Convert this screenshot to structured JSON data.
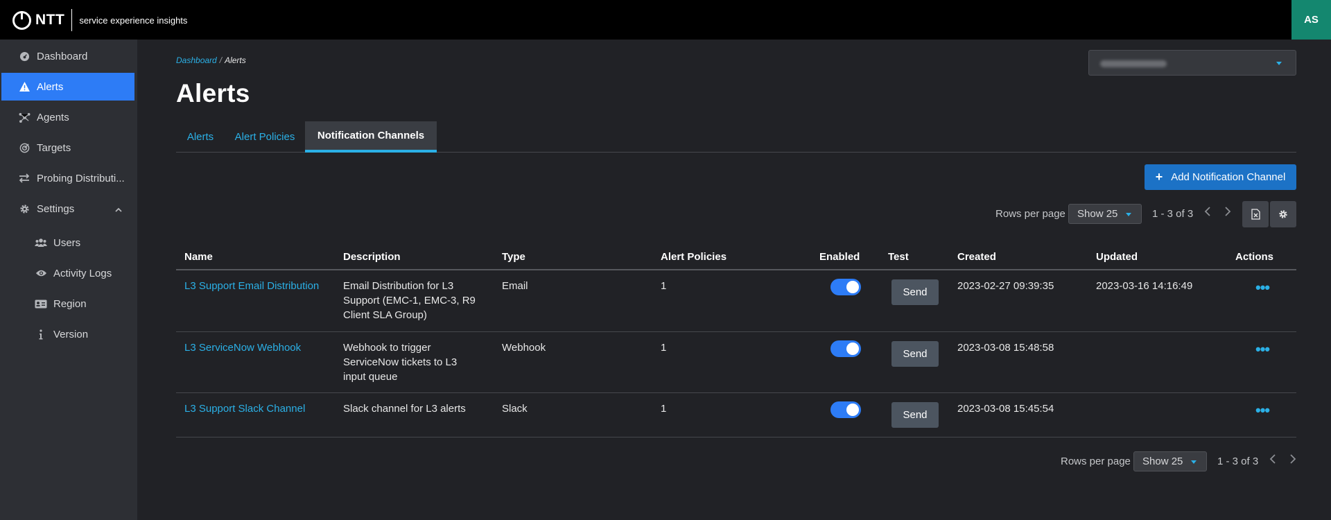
{
  "header": {
    "logo_text": "NTT",
    "app_subtitle": "service experience insights",
    "user_initials": "AS"
  },
  "sidebar": {
    "items": [
      {
        "label": "Dashboard",
        "icon": "dashboard-icon"
      },
      {
        "label": "Alerts",
        "icon": "warning-icon",
        "active": true
      },
      {
        "label": "Agents",
        "icon": "agents-icon"
      },
      {
        "label": "Targets",
        "icon": "target-icon"
      },
      {
        "label": "Probing Distributi...",
        "icon": "swap-arrows-icon"
      },
      {
        "label": "Settings",
        "icon": "gear-icon",
        "expanded": true
      },
      {
        "label": "Users",
        "icon": "users-icon"
      },
      {
        "label": "Activity Logs",
        "icon": "eye-icon"
      },
      {
        "label": "Region",
        "icon": "id-card-icon"
      },
      {
        "label": "Version",
        "icon": "info-icon"
      }
    ]
  },
  "breadcrumb": {
    "root": "Dashboard",
    "separator": "/",
    "current": "Alerts"
  },
  "page": {
    "title": "Alerts"
  },
  "tabs": [
    {
      "label": "Alerts"
    },
    {
      "label": "Alert Policies"
    },
    {
      "label": "Notification Channels",
      "active": true
    }
  ],
  "toolbar": {
    "add_label": "Add Notification Channel"
  },
  "pager": {
    "rows_per_page_label": "Rows per page",
    "show_value": "Show 25",
    "range": "1 - 3 of 3"
  },
  "table": {
    "columns": [
      "Name",
      "Description",
      "Type",
      "Alert Policies",
      "Enabled",
      "Test",
      "Created",
      "Updated",
      "Actions"
    ],
    "rows": [
      {
        "name": "L3 Support Email Distribution",
        "description": "Email Distribution for L3 Support (EMC-1, EMC-3, R9 Client SLA Group)",
        "type": "Email",
        "alert_policies": "1",
        "enabled": true,
        "test_label": "Send",
        "created": "2023-02-27 09:39:35",
        "updated": "2023-03-16 14:16:49"
      },
      {
        "name": "L3 ServiceNow Webhook",
        "description": "Webhook to trigger ServiceNow tickets to L3 input queue",
        "type": "Webhook",
        "alert_policies": "1",
        "enabled": true,
        "test_label": "Send",
        "created": "2023-03-08 15:48:58",
        "updated": ""
      },
      {
        "name": "L3 Support Slack Channel",
        "description": "Slack channel for L3 alerts",
        "type": "Slack",
        "alert_policies": "1",
        "enabled": true,
        "test_label": "Send",
        "created": "2023-03-08 15:45:54",
        "updated": ""
      }
    ]
  },
  "colors": {
    "accent": "#2bb0e6",
    "active_nav": "#2d7cf6",
    "primary_button": "#1c72c6",
    "avatar": "#14876f"
  }
}
